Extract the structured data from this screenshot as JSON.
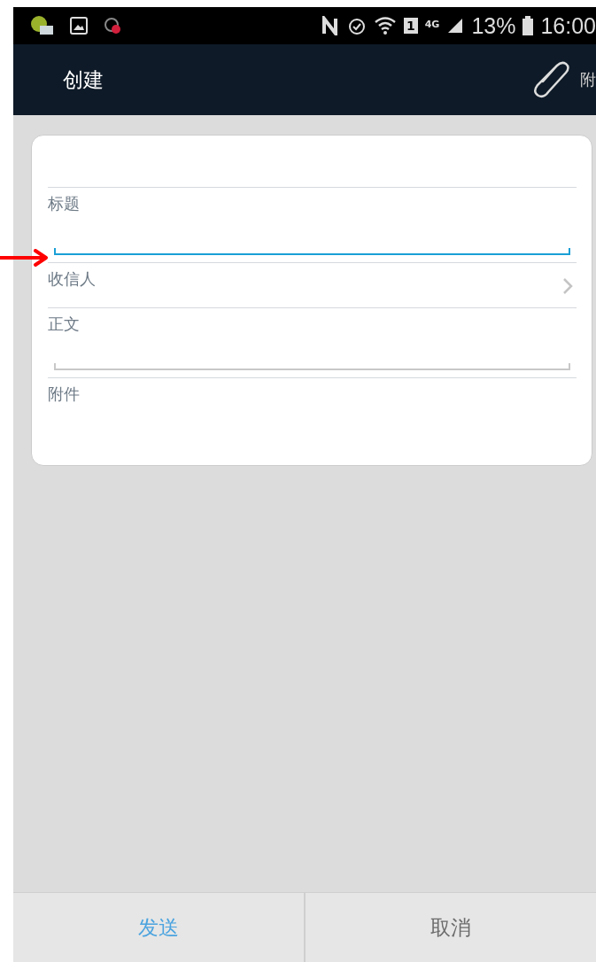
{
  "status_bar": {
    "sim": "1",
    "network": "4G",
    "battery": "13%",
    "time": "16:00"
  },
  "header": {
    "title": "创建",
    "action": "附"
  },
  "form": {
    "fields": [
      {
        "kind": "input",
        "label": "标题",
        "focused": true
      },
      {
        "kind": "picker",
        "label": "收信人"
      },
      {
        "kind": "input",
        "label": "正文",
        "focused": false
      },
      {
        "kind": "attachments",
        "label": "附件"
      }
    ]
  },
  "buttons": [
    {
      "label": "发送",
      "kind": "primary"
    },
    {
      "label": "取消",
      "kind": "secondary"
    }
  ]
}
